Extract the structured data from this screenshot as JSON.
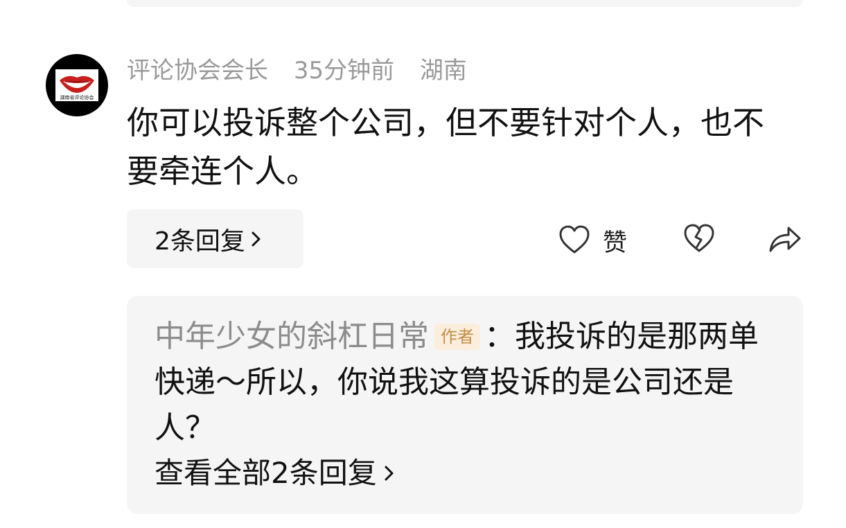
{
  "comment": {
    "author": "评论协会会长",
    "time": "35分钟前",
    "location": "湖南",
    "avatar_text": "湖南省评论协会",
    "text": "你可以投诉整个公司，但不要针对个人，也不要牵连个人。",
    "reply_count_label": "2条回复",
    "like_label": "赞",
    "icons": {
      "like": "heart-outline-icon",
      "dislike": "broken-heart-icon",
      "share": "share-arrow-icon",
      "chevron": "chevron-right-icon"
    }
  },
  "reply": {
    "author": "中年少女的斜杠日常",
    "badge": "作者",
    "separator": "：",
    "text": "我投诉的是那两单快递～所以，你说我这算投诉的是公司还是人？",
    "view_all_label": "查看全部2条回复"
  },
  "colors": {
    "meta_gray": "#9a9a9a",
    "panel_bg": "#f5f5f5",
    "badge_bg": "#fbeedd",
    "badge_text": "#c48e45"
  }
}
